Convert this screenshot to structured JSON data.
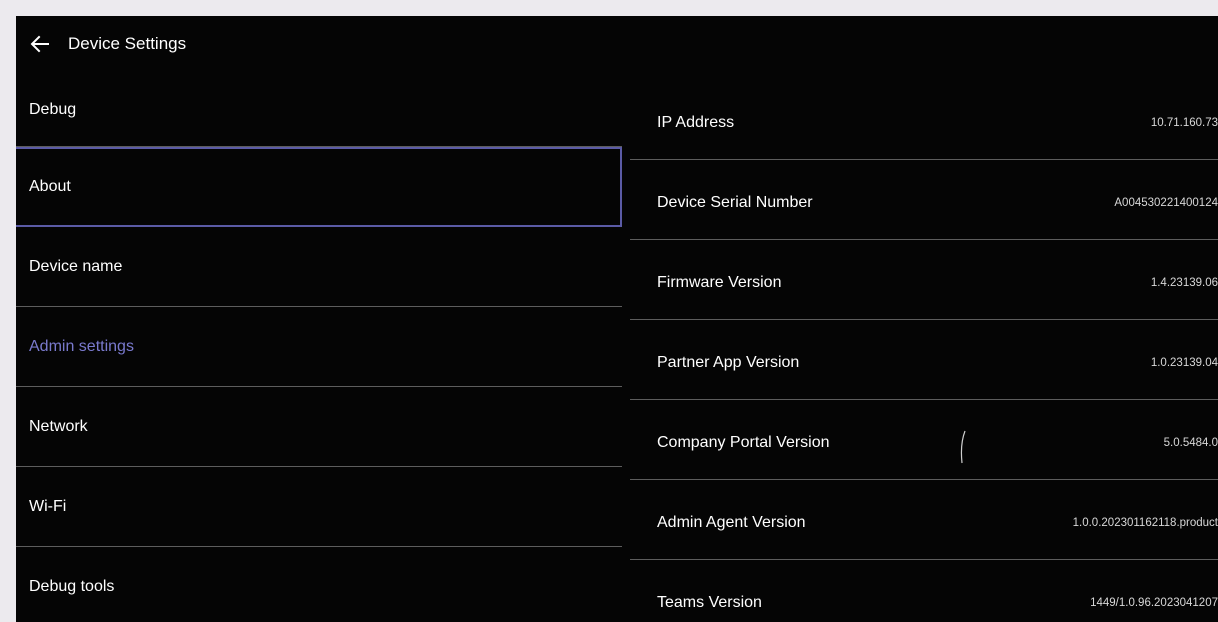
{
  "header": {
    "title": "Device Settings",
    "back_icon": "arrow-left-icon"
  },
  "menu": {
    "items": [
      {
        "label": "Debug"
      },
      {
        "label": "About",
        "state": "focused"
      },
      {
        "label": "Device name"
      },
      {
        "label": "Admin settings",
        "state": "highlighted"
      },
      {
        "label": "Network"
      },
      {
        "label": "Wi-Fi"
      },
      {
        "label": "Debug tools"
      }
    ]
  },
  "about": {
    "rows": [
      {
        "key": "IP Address",
        "value": "10.71.160.73"
      },
      {
        "key": "Device Serial Number",
        "value": "A004530221400124"
      },
      {
        "key": "Firmware Version",
        "value": "1.4.23139.06"
      },
      {
        "key": "Partner App Version",
        "value": "1.0.23139.04"
      },
      {
        "key": "Company Portal Version",
        "value": "5.0.5484.0"
      },
      {
        "key": "Admin Agent Version",
        "value": "1.0.0.202301162118.product"
      },
      {
        "key": "Teams Version",
        "value": "1449/1.0.96.2023041207"
      }
    ]
  },
  "colors": {
    "background": "#050505",
    "accent": "#7a7ace",
    "focus_border": "#5b5ba6",
    "divider": "#5d5d5d"
  }
}
